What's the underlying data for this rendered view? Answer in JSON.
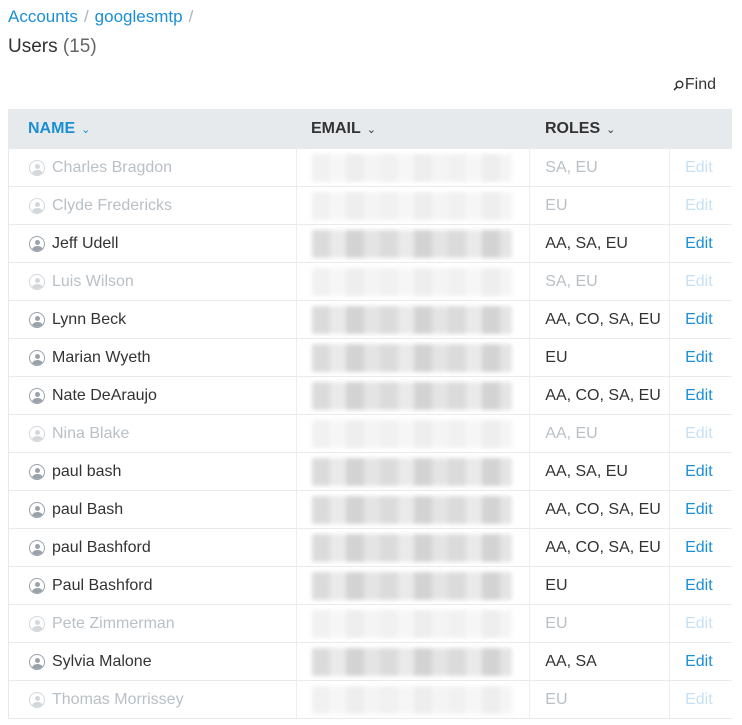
{
  "breadcrumb": {
    "accounts": "Accounts",
    "account": "googlesmtp",
    "sep": "/"
  },
  "page": {
    "title": "Users",
    "count": "(15)"
  },
  "find": {
    "label": "Find"
  },
  "columns": {
    "name": "NAME",
    "email": "EMAIL",
    "roles": "ROLES"
  },
  "colors": {
    "link": "#1a8fd6",
    "header_bg": "#e7eaed",
    "inactive_text": "#b9c0c6"
  },
  "edit_label": "Edit",
  "users": [
    {
      "name": "Charles Bragdon",
      "roles": "SA, EU",
      "active": false
    },
    {
      "name": "Clyde Fredericks",
      "roles": "EU",
      "active": false
    },
    {
      "name": "Jeff Udell",
      "roles": "AA, SA, EU",
      "active": true
    },
    {
      "name": "Luis Wilson",
      "roles": "SA, EU",
      "active": false
    },
    {
      "name": "Lynn Beck",
      "roles": "AA, CO, SA, EU",
      "active": true
    },
    {
      "name": "Marian Wyeth",
      "roles": "EU",
      "active": true
    },
    {
      "name": "Nate DeAraujo",
      "roles": "AA, CO, SA, EU",
      "active": true
    },
    {
      "name": "Nina Blake",
      "roles": "AA, EU",
      "active": false
    },
    {
      "name": "paul bash",
      "roles": "AA, SA, EU",
      "active": true
    },
    {
      "name": "paul Bash",
      "roles": "AA, CO, SA, EU",
      "active": true
    },
    {
      "name": "paul Bashford",
      "roles": "AA, CO, SA, EU",
      "active": true
    },
    {
      "name": "Paul Bashford",
      "roles": "EU",
      "active": true
    },
    {
      "name": "Pete Zimmerman",
      "roles": "EU",
      "active": false
    },
    {
      "name": "Sylvia Malone",
      "roles": "AA, SA",
      "active": true
    },
    {
      "name": "Thomas Morrissey",
      "roles": "EU",
      "active": false
    }
  ]
}
